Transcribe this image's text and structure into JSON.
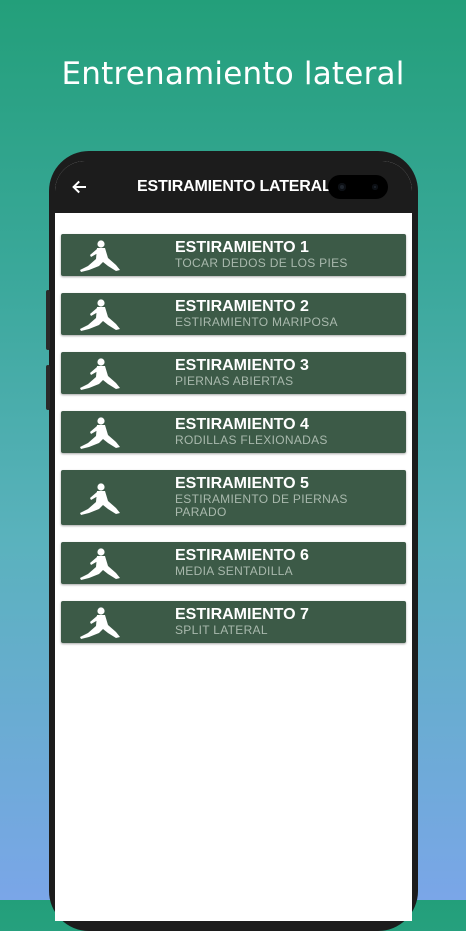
{
  "headline": "Entrenamiento lateral",
  "appbar": {
    "title": "ESTIRAMIENTO LATERAL",
    "back_icon": "arrow-left-icon"
  },
  "items": [
    {
      "title": "ESTIRAMIENTO 1",
      "subtitle": "TOCAR DEDOS DE LOS PIES",
      "icon": "stretching-figure-icon"
    },
    {
      "title": "ESTIRAMIENTO 2",
      "subtitle": "ESTIRAMIENTO MARIPOSA",
      "icon": "stretching-figure-icon"
    },
    {
      "title": "ESTIRAMIENTO 3",
      "subtitle": "PIERNAS ABIERTAS",
      "icon": "stretching-figure-icon"
    },
    {
      "title": "ESTIRAMIENTO 4",
      "subtitle": "RODILLAS FLEXIONADAS",
      "icon": "stretching-figure-icon"
    },
    {
      "title": "ESTIRAMIENTO 5",
      "subtitle": "ESTIRAMIENTO DE PIERNAS PARADO",
      "icon": "stretching-figure-icon"
    },
    {
      "title": "ESTIRAMIENTO 6",
      "subtitle": "MEDIA SENTADILLA",
      "icon": "stretching-figure-icon"
    },
    {
      "title": "ESTIRAMIENTO 7",
      "subtitle": "SPLIT LATERAL",
      "icon": "stretching-figure-icon"
    }
  ],
  "colors": {
    "card": "#3c5a47",
    "appbar": "#1c1c1c",
    "subtitle": "#a9b9ad",
    "background_top": "#239f7a",
    "background_bottom": "#7aa6e8"
  }
}
